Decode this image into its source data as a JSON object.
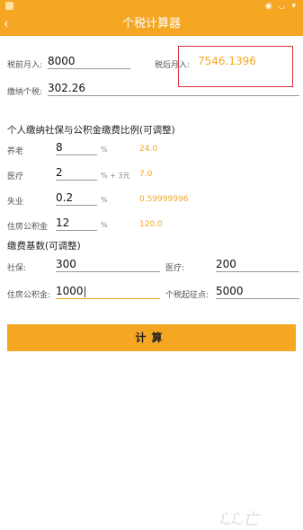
{
  "app": {
    "title": "个税计算器"
  },
  "status": {
    "time": ""
  },
  "income": {
    "pre_label": "税前月入:",
    "pre_value": "8000",
    "after_label": "税后月入:",
    "after_value": "7546.1396",
    "tax_label": "缴纳个税:",
    "tax_value": "302.26"
  },
  "ratio_section": {
    "title": "个人缴纳社保与公积金缴费比例(可调整)",
    "rows": [
      {
        "label": "养老",
        "value": "8",
        "unit": "%",
        "amount": "24.0"
      },
      {
        "label": "医疗",
        "value": "2",
        "unit": "% + 3元",
        "amount": "7.0"
      },
      {
        "label": "失业",
        "value": "0.2",
        "unit": "%",
        "amount": "0.59999996"
      },
      {
        "label": "住房公积金",
        "value": "12",
        "unit": "%",
        "amount": "120.0"
      }
    ]
  },
  "base_section": {
    "title": "缴费基数(可调整)",
    "social_label": "社保:",
    "social_value": "300",
    "medical_label": "医疗:",
    "medical_value": "200",
    "housing_label": "住房公积金:",
    "housing_value": "1000",
    "threshold_label": "个税起征点:",
    "threshold_value": "5000"
  },
  "calc_button": {
    "label": "计算"
  },
  "colors": {
    "accent": "#f5a623",
    "highlight": "#d9343a"
  }
}
